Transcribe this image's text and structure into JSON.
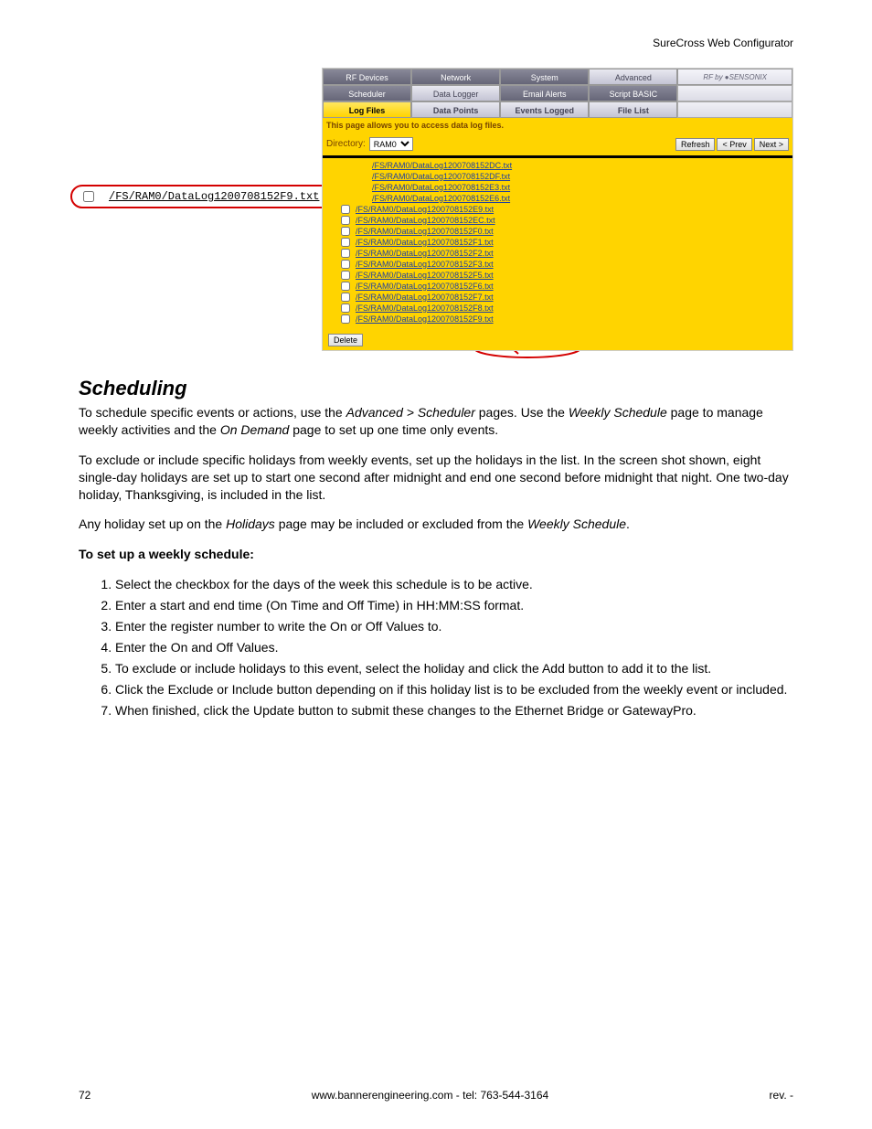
{
  "header_right": "SureCross Web Configurator",
  "app": {
    "tabs1": [
      "RF Devices",
      "Network",
      "System",
      "Advanced"
    ],
    "brand": "RF by ●SENSONIX",
    "tabs2": [
      "Scheduler",
      "Data Logger",
      "Email Alerts",
      "Script BASIC"
    ],
    "tabs3": [
      "Log Files",
      "Data Points",
      "Events Logged",
      "File List"
    ],
    "desc": "This page allows you to access data log files.",
    "dir_label": "Directory:",
    "dir_value": "RAM0",
    "refresh": "Refresh",
    "prev": "< Prev",
    "next": "Next >",
    "delete": "Delete",
    "files": [
      "/FS/RAM0/DataLog1200708152DC.txt",
      "/FS/RAM0/DataLog1200708152DF.txt",
      "/FS/RAM0/DataLog1200708152E3.txt",
      "/FS/RAM0/DataLog1200708152E6.txt",
      "/FS/RAM0/DataLog1200708152E9.txt",
      "/FS/RAM0/DataLog1200708152EC.txt",
      "/FS/RAM0/DataLog1200708152F0.txt",
      "/FS/RAM0/DataLog1200708152F1.txt",
      "/FS/RAM0/DataLog1200708152F2.txt",
      "/FS/RAM0/DataLog1200708152F3.txt",
      "/FS/RAM0/DataLog1200708152F5.txt",
      "/FS/RAM0/DataLog1200708152F6.txt",
      "/FS/RAM0/DataLog1200708152F7.txt",
      "/FS/RAM0/DataLog1200708152F8.txt",
      "/FS/RAM0/DataLog1200708152F9.txt"
    ],
    "callout_file": "/FS/RAM0/DataLog1200708152F9.txt"
  },
  "section_title": "Scheduling",
  "para1a": "To schedule specific events or actions, use the ",
  "para1b": "Advanced > Scheduler",
  "para1c": " pages. Use the ",
  "para1d": "Weekly Schedule",
  "para1e": " page to manage weekly activities and the ",
  "para1f": "On Demand",
  "para1g": " page to set up one time only events.",
  "para2": "To exclude or include specific holidays from weekly events, set up the holidays in the list. In the screen shot shown, eight single-day holidays are set up to start one second after midnight and end one second before midnight that night. One two-day holiday, Thanksgiving, is included in the list.",
  "para3a": "Any holiday set up on the ",
  "para3b": "Holidays",
  "para3c": " page may be included or excluded from the ",
  "para3d": "Weekly Schedule",
  "para3e": ".",
  "setup_heading": "To set up a weekly schedule:",
  "steps": [
    "Select the checkbox for the days of the week this schedule is to be active.",
    "Enter a start and end time (On Time and Off Time) in HH:MM:SS format.",
    "Enter the register number to write the On or Off Values to.",
    "Enter the On and Off Values.",
    "To exclude or include holidays to this event, select the holiday and click the Add button to add it to the list.",
    "Click the Exclude or Include button depending on if this holiday list is to be excluded from the weekly event or included.",
    "When finished, click the Update button to submit these changes to the Ethernet Bridge or GatewayPro."
  ],
  "footer_page": "72",
  "footer_center": "www.bannerengineering.com - tel: 763-544-3164",
  "footer_right": "rev. -"
}
